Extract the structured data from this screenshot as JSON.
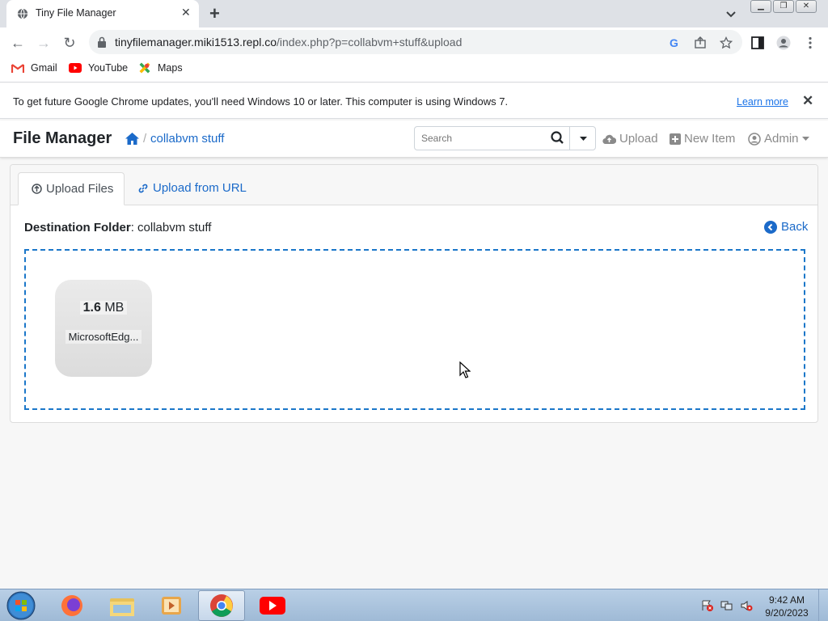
{
  "browser": {
    "tab_title": "Tiny File Manager",
    "url_host": "tinyfilemanager.miki1513.repl.co",
    "url_path": "/index.php?p=collabvm+stuff&upload",
    "bookmarks": [
      "Gmail",
      "YouTube",
      "Maps"
    ],
    "infobar_message": "To get future Google Chrome updates, you'll need Windows 10 or later. This computer is using Windows 7.",
    "infobar_link": "Learn more"
  },
  "app": {
    "brand": "File Manager",
    "breadcrumb_sep": "/",
    "breadcrumb_folder": "collabvm stuff",
    "search_placeholder": "Search",
    "nav_upload": "Upload",
    "nav_new_item": "New Item",
    "nav_admin": "Admin"
  },
  "upload": {
    "tab_upload_files": "Upload Files",
    "tab_upload_url": "Upload from URL",
    "dest_label": "Destination Folder",
    "dest_value": ": collabvm stuff",
    "back_label": "Back",
    "file": {
      "size_value": "1.6",
      "size_unit": "MB",
      "name": "MicrosoftEdg..."
    }
  },
  "taskbar": {
    "time": "9:42 AM",
    "date": "9/20/2023"
  }
}
